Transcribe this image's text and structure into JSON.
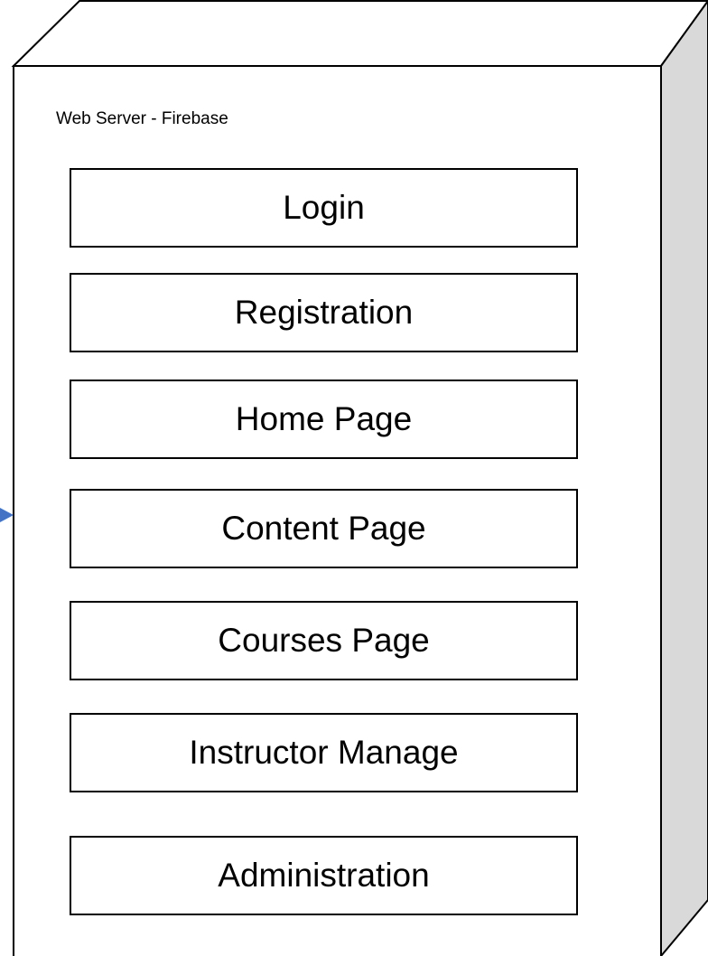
{
  "diagram": {
    "node_label": "Web Server - Firebase",
    "components": [
      "Login",
      "Registration",
      "Home Page",
      "Content Page",
      "Courses Page",
      "Instructor Manage",
      "Administration"
    ]
  },
  "colors": {
    "outline": "#000000",
    "node_front": "#ffffff",
    "node_top": "#ffffff",
    "node_side": "#d9d9d9",
    "incoming_arrow": "#4472c4"
  },
  "icons": {
    "incoming_arrow": "arrowhead-icon"
  }
}
